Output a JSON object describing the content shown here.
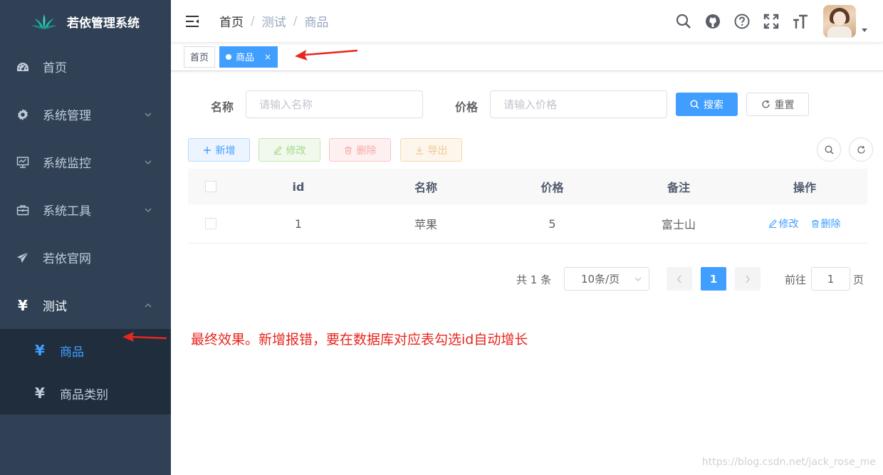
{
  "app": {
    "title": "若依管理系统"
  },
  "sidebar": {
    "items": [
      {
        "label": "首页",
        "icon": "dashboard-icon"
      },
      {
        "label": "系统管理",
        "icon": "gear-icon"
      },
      {
        "label": "系统监控",
        "icon": "monitor-icon"
      },
      {
        "label": "系统工具",
        "icon": "toolbox-icon"
      },
      {
        "label": "若依官网",
        "icon": "paper-plane-icon"
      },
      {
        "label": "测试",
        "icon": "yen-icon"
      }
    ],
    "submenu": [
      {
        "label": "商品",
        "icon": "yen-icon",
        "active": true
      },
      {
        "label": "商品类别",
        "icon": "yen-icon",
        "active": false
      }
    ]
  },
  "navbar": {
    "breadcrumb": [
      "首页",
      "测试",
      "商品"
    ]
  },
  "tags": {
    "home": "首页",
    "active": "商品",
    "close": "×"
  },
  "search": {
    "name_label": "名称",
    "name_placeholder": "请输入名称",
    "price_label": "价格",
    "price_placeholder": "请输入价格",
    "search_button": "搜索",
    "reset_button": "重置"
  },
  "toolbar": {
    "add": "新增",
    "edit": "修改",
    "delete": "删除",
    "export": "导出"
  },
  "table": {
    "headers": [
      "id",
      "名称",
      "价格",
      "备注",
      "操作"
    ],
    "rows": [
      {
        "id": "1",
        "name": "苹果",
        "price": "5",
        "remark": "富士山",
        "edit": "修改",
        "delete": "删除"
      }
    ]
  },
  "pagination": {
    "total": "共 1 条",
    "page_size": "10条/页",
    "current_page": "1",
    "goto_label": "前往",
    "goto_value": "1",
    "page_suffix": "页"
  },
  "annotation": {
    "note": "最终效果。新增报错，要在数据库对应表勾选id自动增长"
  },
  "watermark": "https://blog.csdn.net/jack_rose_me",
  "colors": {
    "sidebar_bg": "#304156",
    "submenu_bg": "#1f2d3d",
    "primary": "#409eff",
    "annotation": "#e8261f"
  }
}
